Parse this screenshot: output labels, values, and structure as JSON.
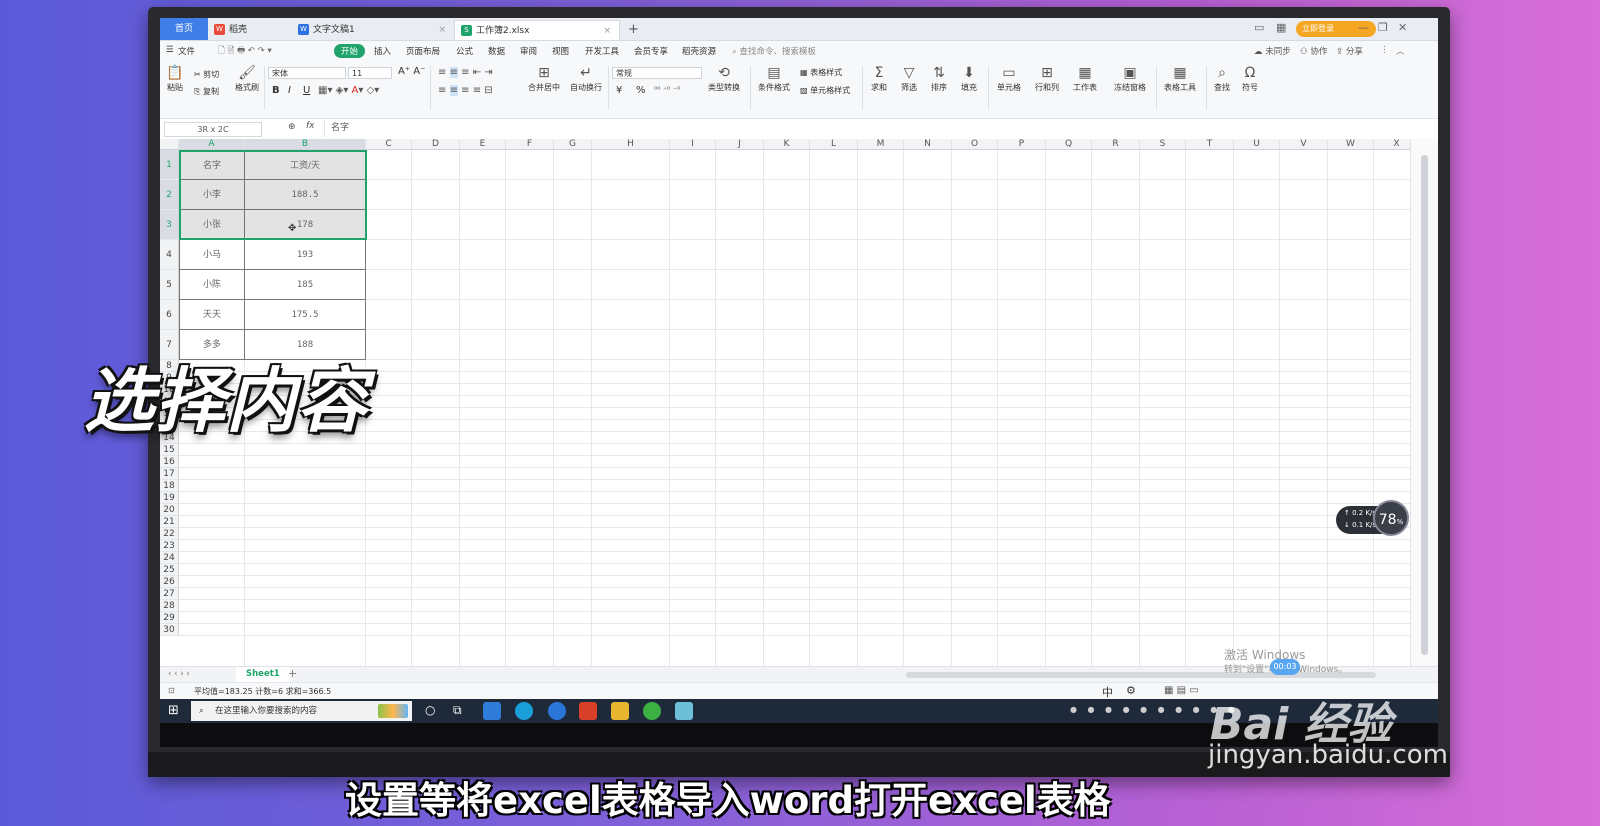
{
  "tabs": {
    "home": "首页",
    "t1": "稻壳",
    "t2": "文字文稿1",
    "t3": "工作簿2.xlsx",
    "close": "×",
    "add": "+"
  },
  "login": "立即登录",
  "menu": {
    "file": "文件",
    "items": [
      "开始",
      "插入",
      "页面布局",
      "公式",
      "数据",
      "审阅",
      "视图",
      "开发工具",
      "会员专享",
      "稻壳资源"
    ],
    "search": "查找命令、搜索模板",
    "right": [
      "未同步",
      "协作",
      "分享"
    ]
  },
  "ribbon": {
    "paste": "粘贴",
    "cut": "剪切",
    "copy": "复制",
    "format_painter": "格式刷",
    "font": "宋体",
    "size": "11",
    "bold": "B",
    "italic": "I",
    "underline": "U",
    "merge": "合并居中",
    "wrap": "自动换行",
    "numfmt": "常规",
    "currency": "¥",
    "percent": "%",
    "convert": "类型转换",
    "cond": "条件格式",
    "table_style": "表格样式",
    "cell_style": "单元格样式",
    "sum": "求和",
    "filter": "筛选",
    "sort": "排序",
    "fill": "填充",
    "cells": "单元格",
    "rowcol": "行和列",
    "sheet": "工作表",
    "freeze": "冻结窗格",
    "tools": "表格工具",
    "find": "查找",
    "symbol": "符号"
  },
  "formula_bar": {
    "namebox": "3R x 2C",
    "fx": "fx",
    "content": "名字"
  },
  "columns": [
    "A",
    "B",
    "C",
    "D",
    "E",
    "F",
    "G",
    "H",
    "I",
    "J",
    "K",
    "L",
    "M",
    "N",
    "O",
    "P",
    "Q",
    "R",
    "S",
    "T",
    "U",
    "V",
    "W",
    "X"
  ],
  "table": {
    "rows": [
      [
        "名字",
        "工资/天"
      ],
      [
        "小李",
        "188.5"
      ],
      [
        "小张",
        "178"
      ],
      [
        "小马",
        "193"
      ],
      [
        "小陈",
        "185"
      ],
      [
        "天天",
        "175.5"
      ],
      [
        "多多",
        "188"
      ]
    ]
  },
  "row_numbers": [
    "1",
    "2",
    "3",
    "4",
    "5",
    "6",
    "7",
    "8",
    "9",
    "10",
    "11",
    "12",
    "13",
    "14",
    "15",
    "16",
    "17",
    "18",
    "19",
    "20",
    "21",
    "22",
    "23",
    "24",
    "25",
    "26",
    "27",
    "28",
    "29",
    "30"
  ],
  "sheet_tab": "Sheet1",
  "status": "平均值=183.25  计数=6  求和=366.5",
  "taskbar": {
    "search": "在这里输入你要搜索的内容",
    "ime": "中"
  },
  "activate": [
    "激活 Windows",
    "转到\"设置\"以激活 Windows。"
  ],
  "net": {
    "up": "0.2",
    "down": "0.1",
    "unit": "K/s",
    "percent": "78",
    "percent_sign": "%"
  },
  "timer": "00:03",
  "overlay_title": "选择内容",
  "subtitle": "设置等将excel表格导入word打开excel表格",
  "watermark": {
    "brand": "Bai 经验",
    "url": "jingyan.baidu.com"
  }
}
